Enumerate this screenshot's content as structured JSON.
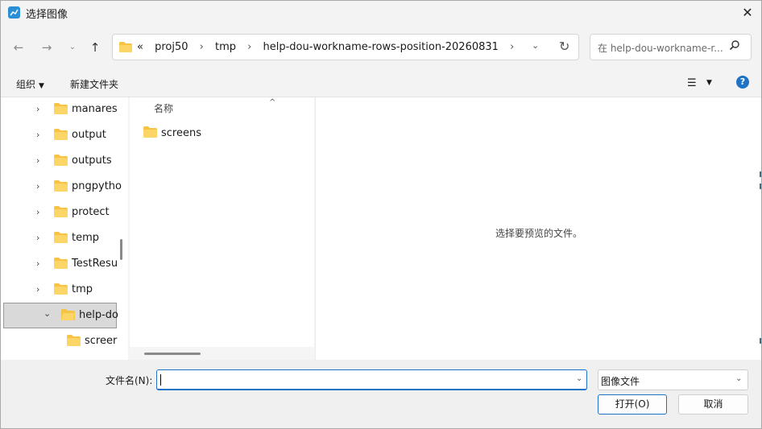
{
  "window": {
    "title": "选择图像"
  },
  "nav": {
    "back_icon": "arrow-left-icon",
    "forward_icon": "arrow-right-icon",
    "recent_icon": "chevron-down-icon",
    "up_icon": "arrow-up-icon",
    "breadcrumb_overflow": "«",
    "breadcrumbs": [
      "proj50",
      "tmp",
      "help-dou-workname-rows-position-20260831"
    ],
    "search_placeholder": "在 help-dou-workname-r..."
  },
  "toolbar": {
    "organize_label": "组织",
    "new_folder_label": "新建文件夹"
  },
  "tree": {
    "items": [
      {
        "label": "manares"
      },
      {
        "label": "output"
      },
      {
        "label": "outputs"
      },
      {
        "label": "pngpytho"
      },
      {
        "label": "protect"
      },
      {
        "label": "temp"
      },
      {
        "label": "TestResu"
      },
      {
        "label": "tmp"
      },
      {
        "label": "help-do"
      },
      {
        "label": "screer"
      }
    ]
  },
  "filelist": {
    "column_name": "名称",
    "files": [
      {
        "label": "screens"
      }
    ]
  },
  "preview": {
    "text": "选择要预览的文件。"
  },
  "bottom": {
    "filename_label": "文件名(N):",
    "filename_value": "",
    "filetype_value": "图像文件",
    "open_label": "打开(O)",
    "cancel_label": "取消"
  },
  "colors": {
    "accent": "#1f73c7",
    "folder": "#f6c343"
  }
}
